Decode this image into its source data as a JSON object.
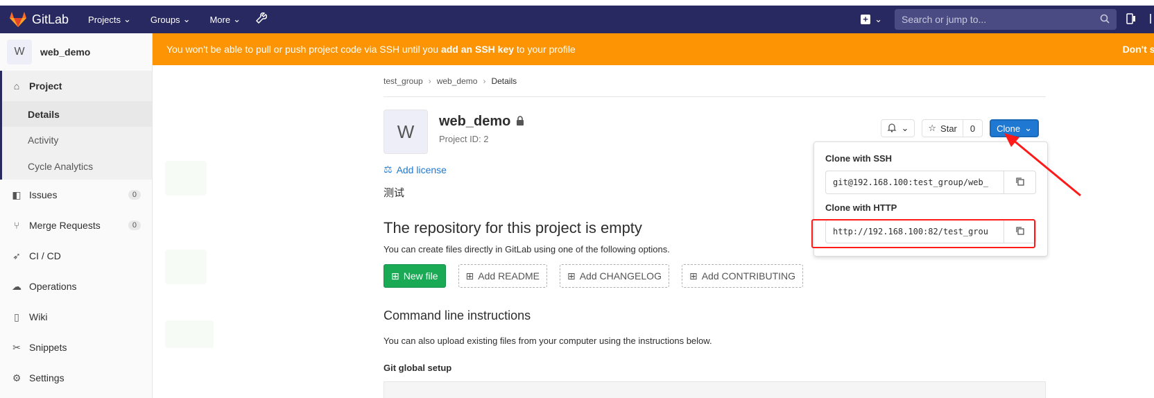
{
  "topbar": {
    "brand": "GitLab",
    "nav": [
      "Projects",
      "Groups",
      "More"
    ],
    "search_placeholder": "Search or jump to..."
  },
  "sidebar": {
    "project_avatar": "W",
    "project_name": "web_demo",
    "section_title": "Project",
    "sub_items": [
      "Details",
      "Activity",
      "Cycle Analytics"
    ],
    "items": [
      {
        "label": "Issues",
        "badge": "0"
      },
      {
        "label": "Merge Requests",
        "badge": "0"
      },
      {
        "label": "CI / CD"
      },
      {
        "label": "Operations"
      },
      {
        "label": "Wiki"
      },
      {
        "label": "Snippets"
      },
      {
        "label": "Settings"
      }
    ]
  },
  "alert": {
    "text_pre": "You won't be able to pull or push project code via SSH until you ",
    "link": "add an SSH key",
    "text_post": " to your profile",
    "dismiss": "Don't sh"
  },
  "breadcrumb": [
    "test_group",
    "web_demo",
    "Details"
  ],
  "project": {
    "avatar": "W",
    "name": "web_demo",
    "id_text": "Project ID: 2",
    "add_license": "Add license",
    "description": "测试"
  },
  "actions": {
    "star_label": "Star",
    "star_count": "0",
    "clone_label": "Clone"
  },
  "empty": {
    "title": "The repository for this project is empty",
    "hint": "You can create files directly in GitLab using one of the following options.",
    "buttons": [
      "New file",
      "Add README",
      "Add CHANGELOG",
      "Add CONTRIBUTING"
    ]
  },
  "cli": {
    "title": "Command line instructions",
    "hint": "You can also upload existing files from your computer using the instructions below.",
    "git_setup": "Git global setup"
  },
  "clone": {
    "ssh_label": "Clone with SSH",
    "ssh_url": "git@192.168.100:test_group/web_",
    "http_label": "Clone with HTTP",
    "http_url": "http://192.168.100:82/test_grou"
  },
  "colors": {
    "navbar": "#292961",
    "alert": "#fc9403",
    "clone_button": "#1f78d1",
    "new_file_button": "#1aaa55",
    "annotation": "#ff1a1a"
  }
}
